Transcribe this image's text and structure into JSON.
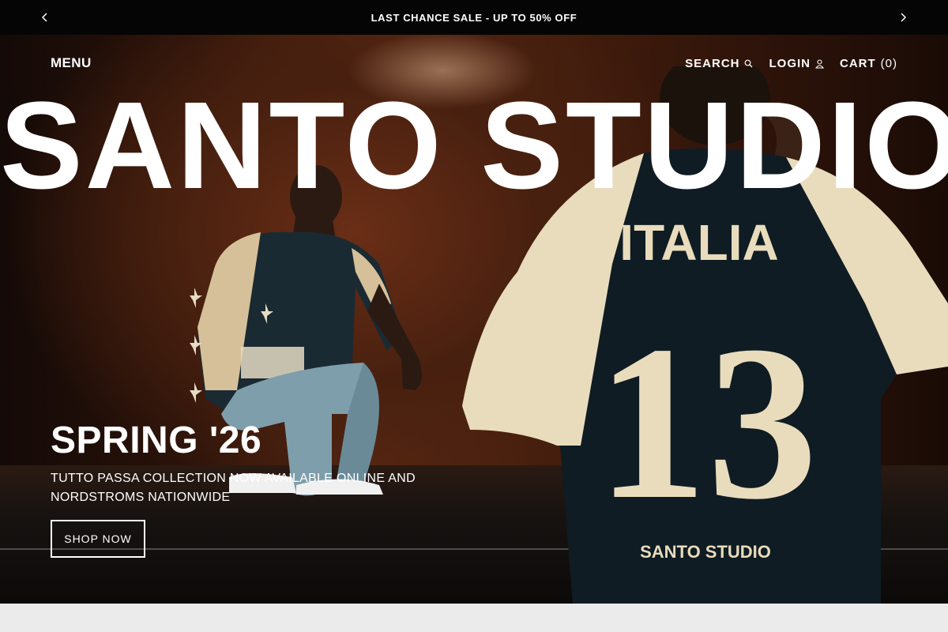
{
  "announcement": {
    "text": "LAST CHANCE SALE - UP TO 50% OFF",
    "prev_icon": "chevron-left-icon",
    "next_icon": "chevron-right-icon"
  },
  "header": {
    "menu_label": "MENU",
    "search_label": "SEARCH",
    "login_label": "LOGIN",
    "cart_label": "CART",
    "cart_count": "(0)"
  },
  "hero": {
    "brand": "SANTO STUDIO",
    "title": "SPRING '26",
    "subtitle": "TUTTO PASSA COLLECTION NOW AVAILABLE ONLINE AND NORDSTROMS NATIONWIDE",
    "cta_label": "SHOP NOW",
    "jersey_text": "ITALIA",
    "jersey_number": "13",
    "jersey_brand": "SANTO STUDIO",
    "image_desc": "Two models in Santo Studio jerseys in a dark wood-paneled room"
  },
  "colors": {
    "bar_bg": "#050505",
    "text": "#ffffff",
    "page_bg": "#ebebeb",
    "jersey_cream": "#e9dcbc",
    "jersey_navy": "#0f1c24"
  }
}
